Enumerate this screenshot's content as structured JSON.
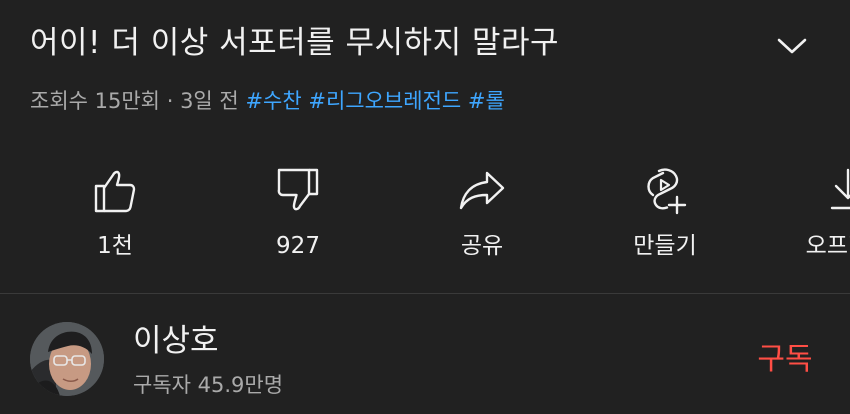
{
  "video": {
    "title": "어이! 더 이상 서포터를 무시하지 말라구",
    "views": "조회수 15만회",
    "separator": "·",
    "age": "3일 전",
    "hashtags": [
      "#수찬",
      "#리그오브레전드",
      "#롤"
    ]
  },
  "actions": {
    "like": {
      "label": "1천",
      "icon": "thumbs-up-icon"
    },
    "dislike": {
      "label": "927",
      "icon": "thumbs-down-icon"
    },
    "share": {
      "label": "공유",
      "icon": "share-icon"
    },
    "remix": {
      "label": "만들기",
      "icon": "remix-plus-icon"
    },
    "offline": {
      "label": "오프라인",
      "icon": "download-icon"
    }
  },
  "channel": {
    "name": "이상호",
    "subscribers": "구독자 45.9만명",
    "subscribe_label": "구독"
  },
  "colors": {
    "background": "#212121",
    "text_primary": "#f1f1f1",
    "text_secondary": "#aaaaaa",
    "hashtag": "#3ea6ff",
    "subscribe": "#ff4e45",
    "divider": "#3a3a3a"
  }
}
